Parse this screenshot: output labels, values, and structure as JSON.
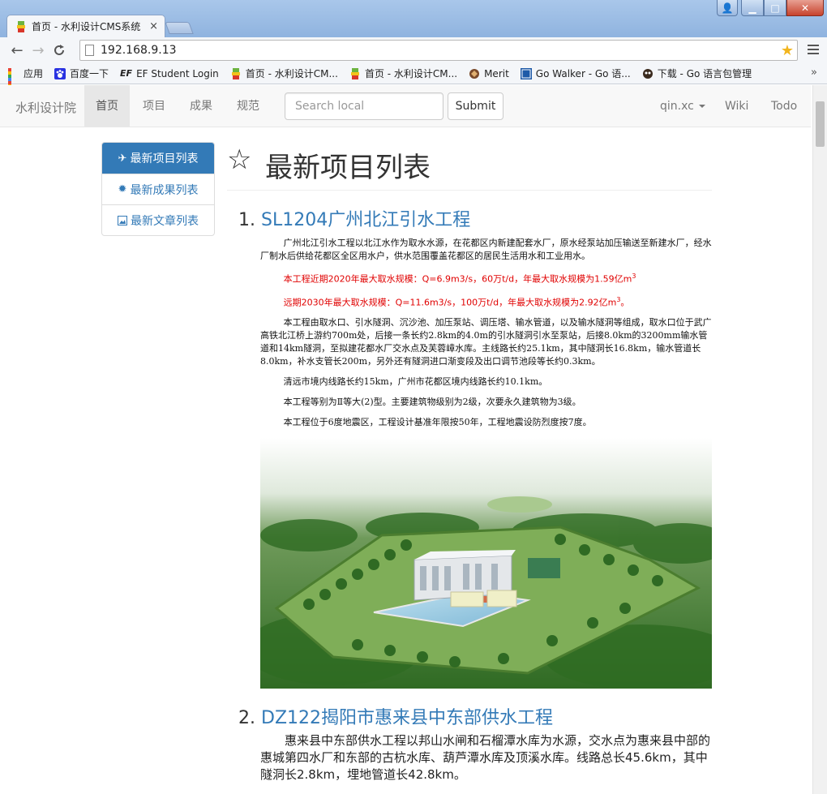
{
  "window": {
    "tab_title": "首页 - 水利设计CMS系统",
    "tab_close": "×",
    "controls": {
      "user": "👤",
      "minimize": "▁",
      "maximize": "□",
      "close": "✕"
    }
  },
  "toolbar": {
    "back": "←",
    "forward": "→",
    "reload": "C",
    "url": "192.168.9.13",
    "bookmark_star": "★"
  },
  "bookmarks": {
    "items": [
      {
        "label": "应用",
        "icon": "apps-grid-icon"
      },
      {
        "label": "百度一下",
        "icon": "baidu-paw-icon"
      },
      {
        "label": "EF Student Login",
        "icon": "ef-logo-icon"
      },
      {
        "label": "首页 - 水利设计CM...",
        "icon": "site-favicon"
      },
      {
        "label": "首页 - 水利设计CM...",
        "icon": "site-favicon"
      },
      {
        "label": "Merit",
        "icon": "merit-icon"
      },
      {
        "label": "Go Walker - Go 语...",
        "icon": "godoc-icon"
      },
      {
        "label": "下载 - Go 语言包管理",
        "icon": "gopher-icon"
      }
    ],
    "more": "»"
  },
  "navbar": {
    "brand": "水利设计院",
    "items": [
      "首页",
      "项目",
      "成果",
      "规范"
    ],
    "search_placeholder": "Search local",
    "submit_label": "Submit",
    "user": "qin.xc",
    "right_items": [
      "Wiki",
      "Todo"
    ]
  },
  "sidebar": {
    "items": [
      {
        "label": "最新项目列表",
        "icon": "plane-icon",
        "glyph": "✈"
      },
      {
        "label": "最新成果列表",
        "icon": "certificate-icon",
        "glyph": "✹"
      },
      {
        "label": "最新文章列表",
        "icon": "picture-icon",
        "glyph": "🖼"
      }
    ]
  },
  "main": {
    "header_icon": "☆",
    "header_title": "最新项目列表",
    "projects": [
      {
        "num": "1.",
        "title": "SL1204广州北江引水工程",
        "paragraphs": [
          "广州北江引水工程以北江水作为取水水源，在花都区内新建配套水厂，原水经泵站加压输送至新建水厂，经水厂制水后供给花都区全区用水户，供水范围覆盖花都区的居民生活用水和工业用水。",
          "本工程由取水口、引水隧洞、沉沙池、加压泵站、调压塔、输水管道，以及输水隧洞等组成，取水口位于武广高铁北江桥上游约700m处，后接一条长约2.8km的4.0m的引水隧洞引水至泵站，后接8.0km的3200mm输水管道和14km隧洞，至拟建花都水厂交水点及芙蓉嶂水库。主线路长约25.1km，其中隧洞长16.8km，输水管道长8.0km，补水支管长200m，另外还有隧洞进口渐变段及出口调节池段等长约0.3km。",
          "清远市境内线路长约15km，广州市花都区境内线路长约10.1km。",
          "本工程等别为Ⅱ等大(2)型。主要建筑物级别为2级，次要永久建筑物为3级。",
          "本工程位于6度地震区，工程设计基准年限按50年，工程地震设防烈度按7度。"
        ],
        "red_lines": [
          {
            "text": "本工程近期2020年最大取水规模：Q=6.9m3/s，60万t/d，年最大取水规模为1.59亿m",
            "sup": "3"
          },
          {
            "text": "远期2030年最大取水规模：Q=11.6m3/s，100万t/d，年最大取水规模为2.92亿m",
            "sup": "3",
            "tail": "。"
          }
        ]
      },
      {
        "num": "2.",
        "title": "DZ122揭阳市惠来县中东部供水工程",
        "description": "惠来县中东部供水工程以邦山水闸和石榴潭水库为水源，交水点为惠来县中部的惠城第四水厂和东部的古杭水库、葫芦潭水库及顶溪水库。线路总长45.6km，其中隧洞长2.8km，埋地管道长42.8km。"
      }
    ]
  },
  "colors": {
    "primary": "#337ab7",
    "red_text": "#e00000",
    "navbar_bg": "#f8f8f8"
  }
}
